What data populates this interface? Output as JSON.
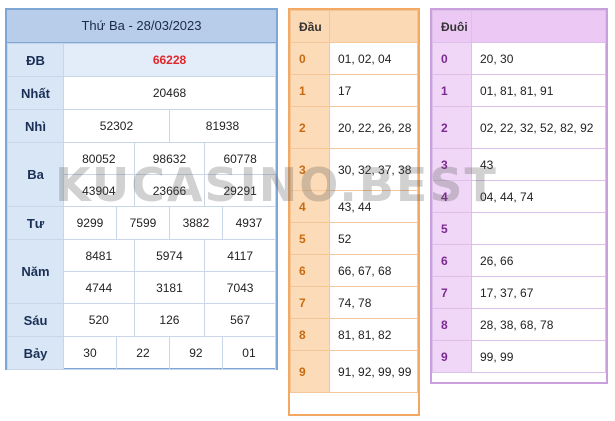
{
  "title": "Thứ Ba - 28/03/2023",
  "labels": {
    "db": "ĐB",
    "nhat": "Nhất",
    "nhi": "Nhì",
    "ba": "Ba",
    "tu": "Tư",
    "nam": "Năm",
    "sau": "Sáu",
    "bay": "Bảy"
  },
  "prizes": {
    "db": "66228",
    "nhat": "20468",
    "nhi": [
      "52302",
      "81938"
    ],
    "ba": [
      "80052",
      "98632",
      "60778",
      "43904",
      "23666",
      "29291"
    ],
    "tu": [
      "9299",
      "7599",
      "3882",
      "4937"
    ],
    "nam": [
      "8481",
      "5974",
      "4117",
      "4744",
      "3181",
      "7043"
    ],
    "sau": [
      "520",
      "126",
      "567"
    ],
    "bay": [
      "30",
      "22",
      "92",
      "01"
    ]
  },
  "dau": {
    "header": "Đầu",
    "rows": [
      {
        "k": "0",
        "v": "01, 02, 04"
      },
      {
        "k": "1",
        "v": "17"
      },
      {
        "k": "2",
        "v": "20, 22, 26, 28"
      },
      {
        "k": "3",
        "v": "30, 32, 37, 38"
      },
      {
        "k": "4",
        "v": "43, 44"
      },
      {
        "k": "5",
        "v": "52"
      },
      {
        "k": "6",
        "v": "66, 67, 68"
      },
      {
        "k": "7",
        "v": "74, 78"
      },
      {
        "k": "8",
        "v": "81, 81, 82"
      },
      {
        "k": "9",
        "v": "91, 92, 99, 99"
      }
    ]
  },
  "duoi": {
    "header": "Đuôi",
    "rows": [
      {
        "k": "0",
        "v": "20, 30"
      },
      {
        "k": "1",
        "v": "01, 81, 81, 91"
      },
      {
        "k": "2",
        "v": "02, 22, 32, 52, 82, 92"
      },
      {
        "k": "3",
        "v": "43"
      },
      {
        "k": "4",
        "v": "04, 44, 74"
      },
      {
        "k": "5",
        "v": ""
      },
      {
        "k": "6",
        "v": "26, 66"
      },
      {
        "k": "7",
        "v": "17, 37, 67"
      },
      {
        "k": "8",
        "v": "28, 38, 68, 78"
      },
      {
        "k": "9",
        "v": "99, 99"
      }
    ]
  },
  "watermark": "KUCASINO.BEST",
  "colors": {
    "special_prize": "#e0262b",
    "main_border": "#7fa7d6",
    "dau_border": "#f3a963",
    "duoi_border": "#c9a0dd"
  }
}
